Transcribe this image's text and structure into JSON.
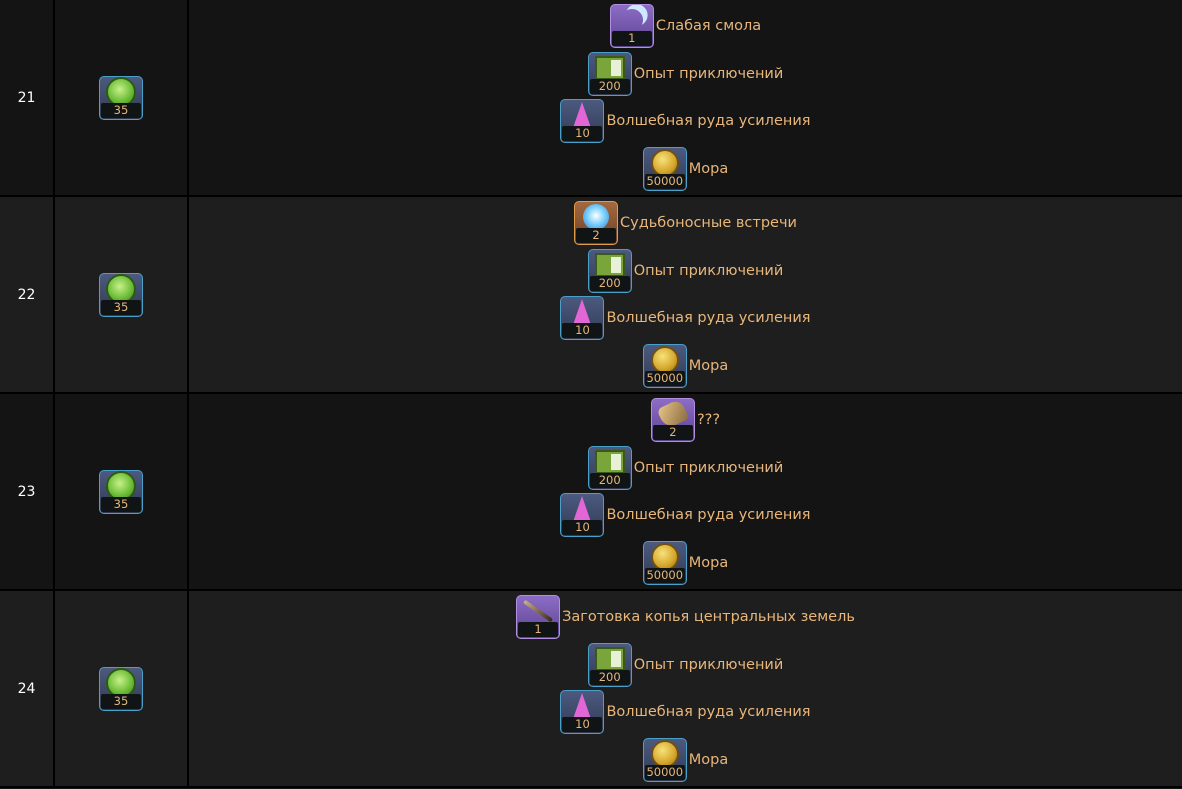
{
  "rows": [
    {
      "level": "21",
      "cost": {
        "icon": "green-orb-icon",
        "qty": "35"
      },
      "rewards": [
        {
          "icon": "moon-resin-icon",
          "rarity": "purple",
          "qty": "1",
          "label": "Слабая смола"
        },
        {
          "icon": "adventure-exp-book-icon",
          "rarity": "blue",
          "qty": "200",
          "label": "Опыт приключений"
        },
        {
          "icon": "crystal-ore-icon",
          "rarity": "blue",
          "qty": "10",
          "label": "Волшебная руда усиления"
        },
        {
          "icon": "mora-coin-icon",
          "rarity": "blue",
          "qty": "50000",
          "label": "Мора"
        }
      ]
    },
    {
      "level": "22",
      "cost": {
        "icon": "green-orb-icon",
        "qty": "35"
      },
      "rewards": [
        {
          "icon": "intertwined-fate-icon",
          "rarity": "gold",
          "qty": "2",
          "label": "Судьбоносные встречи"
        },
        {
          "icon": "adventure-exp-book-icon",
          "rarity": "blue",
          "qty": "200",
          "label": "Опыт приключений"
        },
        {
          "icon": "crystal-ore-icon",
          "rarity": "blue",
          "qty": "10",
          "label": "Волшебная руда усиления"
        },
        {
          "icon": "mora-coin-icon",
          "rarity": "blue",
          "qty": "50000",
          "label": "Мора"
        }
      ]
    },
    {
      "level": "23",
      "cost": {
        "icon": "green-orb-icon",
        "qty": "35"
      },
      "rewards": [
        {
          "icon": "unknown-rock-icon",
          "rarity": "purple",
          "qty": "2",
          "label": "???"
        },
        {
          "icon": "adventure-exp-book-icon",
          "rarity": "blue",
          "qty": "200",
          "label": "Опыт приключений"
        },
        {
          "icon": "crystal-ore-icon",
          "rarity": "blue",
          "qty": "10",
          "label": "Волшебная руда усиления"
        },
        {
          "icon": "mora-coin-icon",
          "rarity": "blue",
          "qty": "50000",
          "label": "Мора"
        }
      ]
    },
    {
      "level": "24",
      "cost": {
        "icon": "green-orb-icon",
        "qty": "35"
      },
      "rewards": [
        {
          "icon": "spear-billet-icon",
          "rarity": "purple",
          "qty": "1",
          "label": "Заготовка копья центральных земель"
        },
        {
          "icon": "adventure-exp-book-icon",
          "rarity": "blue",
          "qty": "200",
          "label": "Опыт приключений"
        },
        {
          "icon": "crystal-ore-icon",
          "rarity": "blue",
          "qty": "10",
          "label": "Волшебная руда усиления"
        },
        {
          "icon": "mora-coin-icon",
          "rarity": "blue",
          "qty": "50000",
          "label": "Мора"
        }
      ]
    }
  ],
  "colors": {
    "label_text": "#e8b67a",
    "level_text": "#ffffff",
    "row_dark": "#141414",
    "row_light": "#1e1e1e"
  }
}
